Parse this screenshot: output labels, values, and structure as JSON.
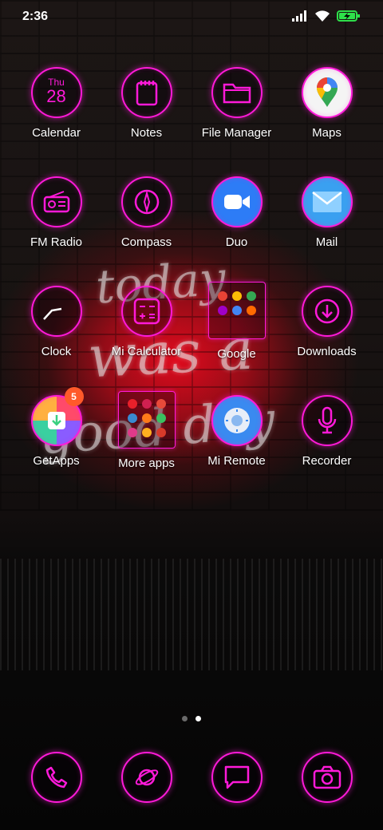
{
  "status_bar": {
    "time": "2:36",
    "icons": [
      "signal-icon",
      "wifi-icon",
      "battery-charging-icon"
    ]
  },
  "wallpaper": {
    "neon_lines": [
      "today",
      "was a",
      "good day"
    ]
  },
  "apps": [
    {
      "label": "Calendar",
      "icon": "calendar-icon",
      "day": "Thu",
      "date": "28"
    },
    {
      "label": "Notes",
      "icon": "notes-icon"
    },
    {
      "label": "File Manager",
      "icon": "folder-icon"
    },
    {
      "label": "Maps",
      "icon": "maps-icon"
    },
    {
      "label": "FM Radio",
      "icon": "radio-icon"
    },
    {
      "label": "Compass",
      "icon": "compass-icon"
    },
    {
      "label": "Duo",
      "icon": "video-camera-icon"
    },
    {
      "label": "Mail",
      "icon": "mail-icon"
    },
    {
      "label": "Clock",
      "icon": "clock-icon"
    },
    {
      "label": "Mi Calculator",
      "icon": "calculator-icon"
    },
    {
      "label": "Google",
      "icon": "folder-google"
    },
    {
      "label": "Downloads",
      "icon": "download-icon"
    },
    {
      "label": "GetApps",
      "icon": "getapps-icon",
      "badge": "5"
    },
    {
      "label": "More apps",
      "icon": "folder-more-apps"
    },
    {
      "label": "Mi Remote",
      "icon": "remote-icon"
    },
    {
      "label": "Recorder",
      "icon": "microphone-icon"
    }
  ],
  "page_indicator": {
    "pages": 2,
    "active": 2
  },
  "dock": [
    {
      "name": "phone",
      "icon": "phone-icon"
    },
    {
      "name": "browser",
      "icon": "planet-icon"
    },
    {
      "name": "messages",
      "icon": "message-icon"
    },
    {
      "name": "camera",
      "icon": "camera-icon"
    }
  ],
  "colors": {
    "neon": "#ff1ad9",
    "badge": "#ff5a2a"
  }
}
